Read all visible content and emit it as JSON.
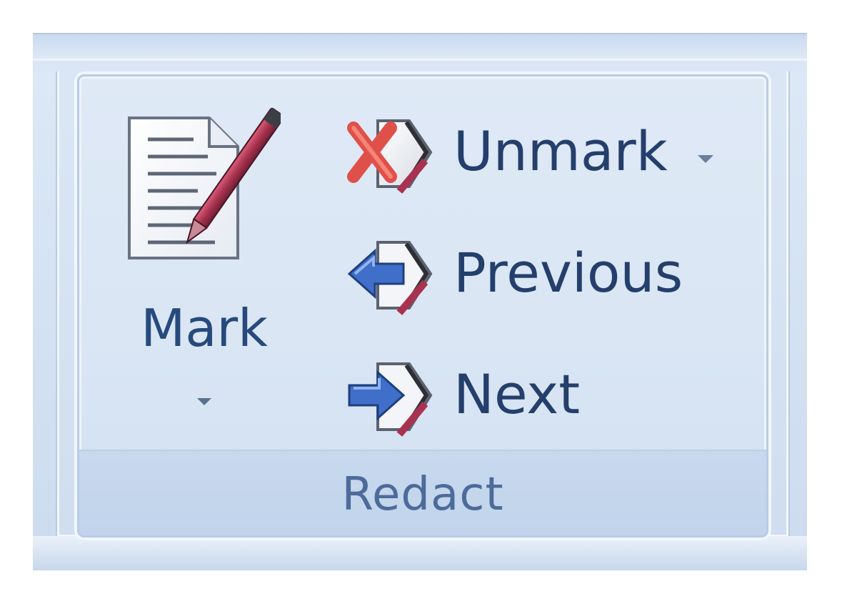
{
  "ribbon": {
    "group": {
      "label": "Redact",
      "buttons": {
        "mark": {
          "label": "Mark",
          "icon": "mark-document-pen-icon",
          "has_dropdown": true
        },
        "unmark": {
          "label": "Unmark",
          "icon": "unmark-red-x-icon",
          "has_dropdown": true
        },
        "previous": {
          "label": "Previous",
          "icon": "previous-arrow-icon",
          "has_dropdown": false
        },
        "next": {
          "label": "Next",
          "icon": "next-arrow-icon",
          "has_dropdown": false
        }
      }
    }
  },
  "colors": {
    "ribbon_background": "#d9e5f4",
    "label_text": "#243f6b",
    "group_label_text": "#4d6b9a",
    "unmark_icon_red": "#e0504a",
    "arrow_icon_blue": "#3f6fc9"
  }
}
